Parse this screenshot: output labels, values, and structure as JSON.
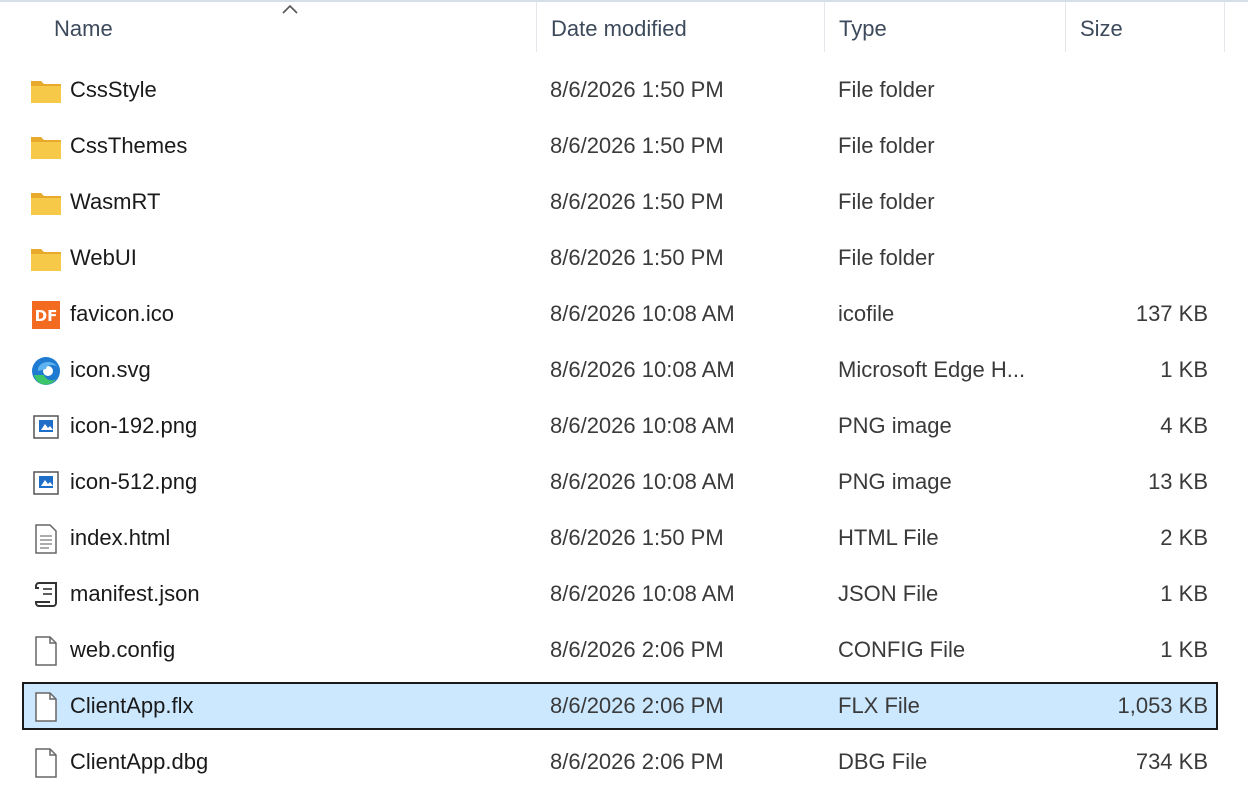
{
  "columns": {
    "name": "Name",
    "date": "Date modified",
    "type": "Type",
    "size": "Size"
  },
  "files": [
    {
      "name": "CssStyle",
      "date": "8/6/2026 1:50 PM",
      "type": "File folder",
      "size": "",
      "icon": "folder-icon"
    },
    {
      "name": "CssThemes",
      "date": "8/6/2026 1:50 PM",
      "type": "File folder",
      "size": "",
      "icon": "folder-icon"
    },
    {
      "name": "WasmRT",
      "date": "8/6/2026 1:50 PM",
      "type": "File folder",
      "size": "",
      "icon": "folder-icon"
    },
    {
      "name": "WebUI",
      "date": "8/6/2026 1:50 PM",
      "type": "File folder",
      "size": "",
      "icon": "folder-icon"
    },
    {
      "name": "favicon.ico",
      "date": "8/6/2026 10:08 AM",
      "type": "icofile",
      "size": "137 KB",
      "icon": "df-app-icon"
    },
    {
      "name": "icon.svg",
      "date": "8/6/2026 10:08 AM",
      "type": "Microsoft Edge H...",
      "size": "1 KB",
      "icon": "edge-icon"
    },
    {
      "name": "icon-192.png",
      "date": "8/6/2026 10:08 AM",
      "type": "PNG image",
      "size": "4 KB",
      "icon": "image-file-icon"
    },
    {
      "name": "icon-512.png",
      "date": "8/6/2026 10:08 AM",
      "type": "PNG image",
      "size": "13 KB",
      "icon": "image-file-icon"
    },
    {
      "name": "index.html",
      "date": "8/6/2026 1:50 PM",
      "type": "HTML File",
      "size": "2 KB",
      "icon": "text-document-icon"
    },
    {
      "name": "manifest.json",
      "date": "8/6/2026 10:08 AM",
      "type": "JSON File",
      "size": "1 KB",
      "icon": "script-file-icon"
    },
    {
      "name": "web.config",
      "date": "8/6/2026 2:06 PM",
      "type": "CONFIG File",
      "size": "1 KB",
      "icon": "blank-file-icon"
    },
    {
      "name": "ClientApp.flx",
      "date": "8/6/2026 2:06 PM",
      "type": "FLX File",
      "size": "1,053 KB",
      "icon": "blank-file-icon",
      "selected": true
    },
    {
      "name": "ClientApp.dbg",
      "date": "8/6/2026 2:06 PM",
      "type": "DBG File",
      "size": "734 KB",
      "icon": "blank-file-icon"
    }
  ],
  "colors": {
    "selection_bg": "#cce8ff",
    "folder": "#f5c344",
    "df_brand": "#f26b21",
    "edge_blue": "#1f7ad1",
    "edge_green": "#3cc46a"
  }
}
